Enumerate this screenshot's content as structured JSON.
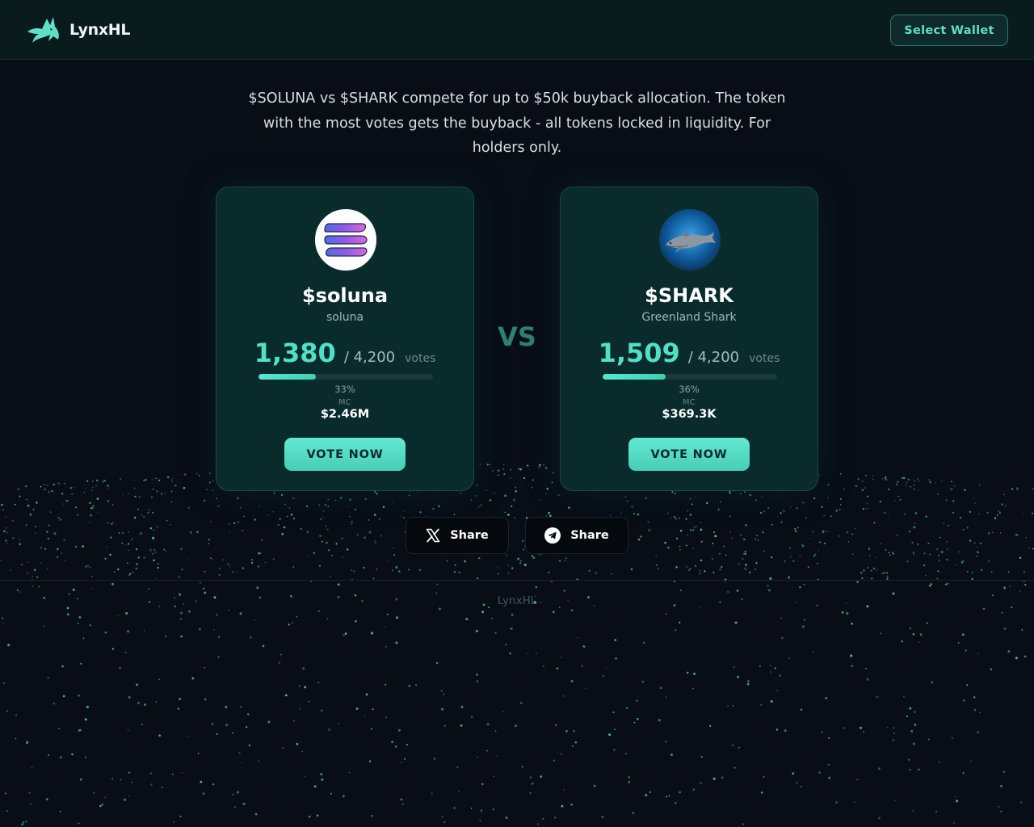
{
  "header": {
    "brand": "LynxHL",
    "wallet_button": "Select Wallet"
  },
  "intro": "$SOLUNA vs $SHARK compete for up to $50k buyback allocation. The token with the most votes gets the buyback - all tokens locked in liquidity. For holders only.",
  "cards": [
    {
      "ticker": "$soluna",
      "name": "soluna",
      "votes": "1,380",
      "total": "/ 4,200",
      "votes_word": "votes",
      "progress": 0.33,
      "percent": "33%",
      "mc_label": "MC",
      "mc_value": "$2.46M",
      "vote_button": "VOTE NOW",
      "logo_icon": "solana-logo-icon"
    },
    {
      "ticker": "$SHARK",
      "name": "Greenland Shark",
      "votes": "1,509",
      "total": "/ 4,200",
      "votes_word": "votes",
      "progress": 0.36,
      "percent": "36%",
      "mc_label": "MC",
      "mc_value": "$369.3K",
      "vote_button": "VOTE NOW",
      "logo_icon": "shark-logo-icon"
    }
  ],
  "vs": "VS",
  "share": {
    "x_label": "Share",
    "telegram_label": "Share"
  },
  "footer": "LynxHL",
  "colors": {
    "accent": "#4fe0c6",
    "background": "#080d16",
    "card": "#0a2b2b"
  }
}
